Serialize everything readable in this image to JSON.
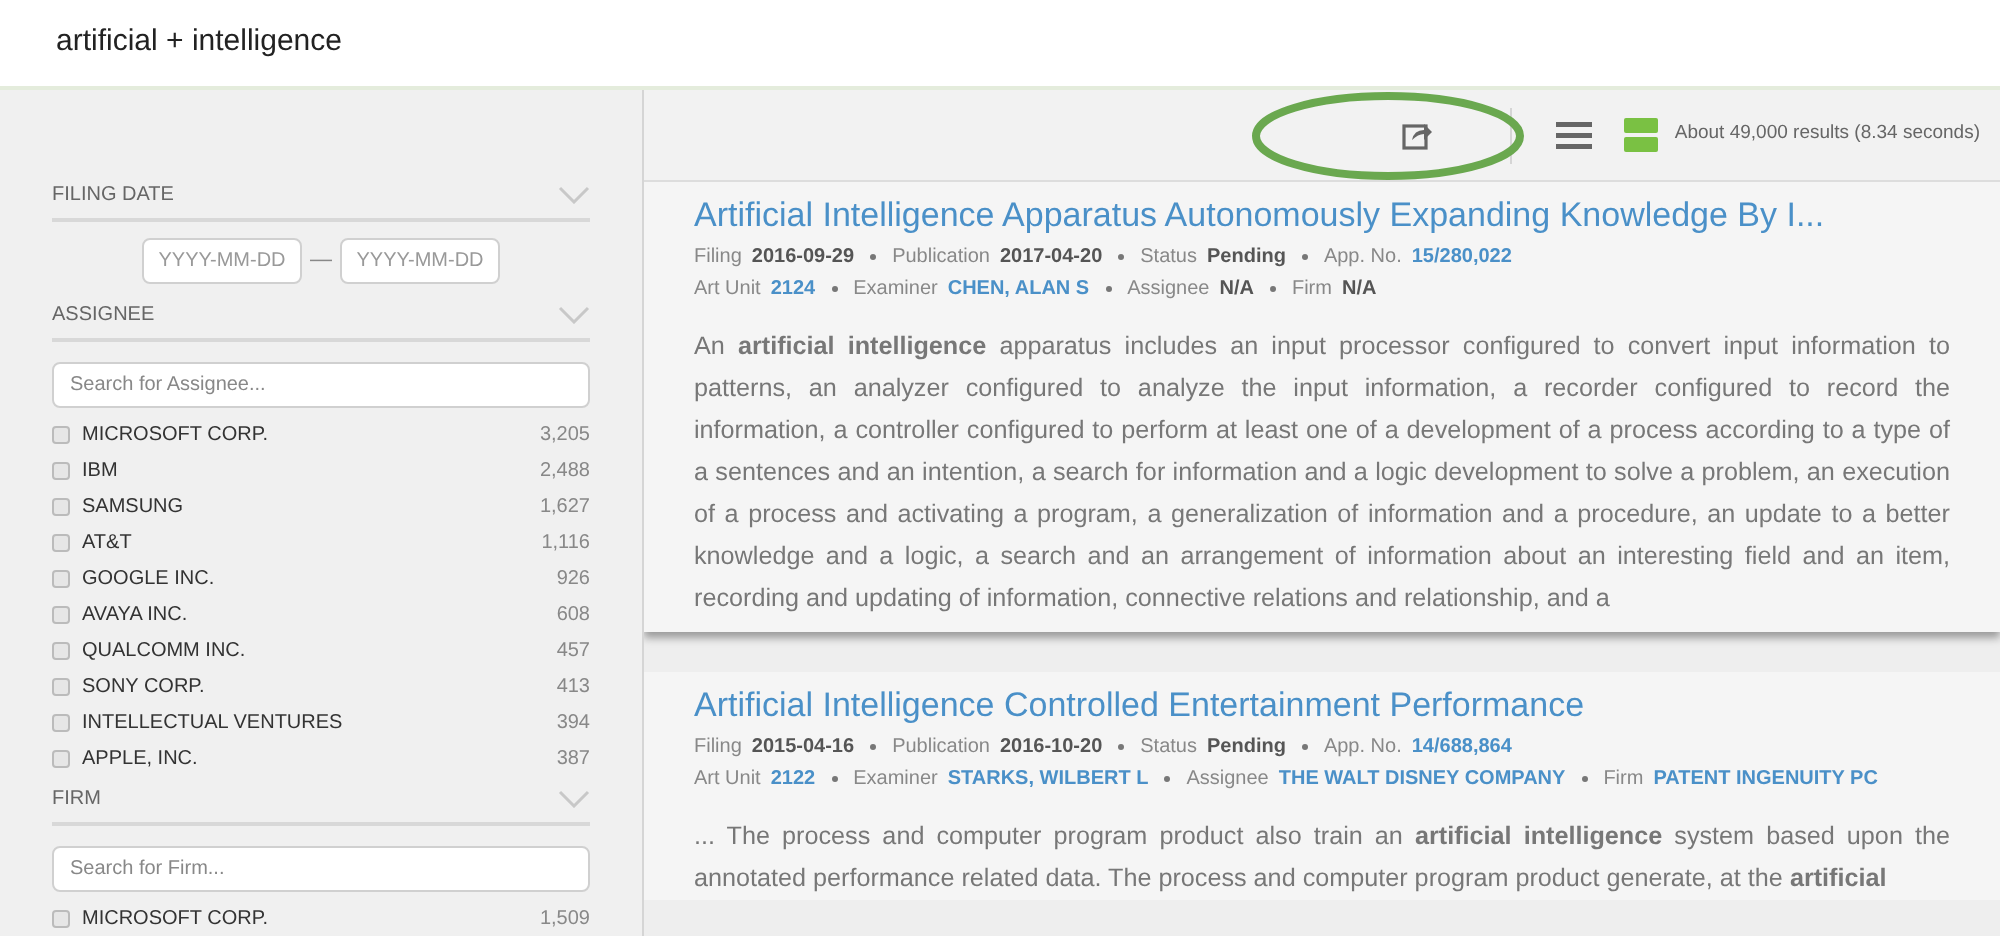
{
  "header": {
    "query": "artificial + intelligence"
  },
  "sidebar": {
    "sections": [
      {
        "title": "FILING DATE",
        "kind": "date",
        "from_placeholder": "YYYY-MM-DD",
        "separator": "—",
        "to_placeholder": "YYYY-MM-DD"
      },
      {
        "title": "ASSIGNEE",
        "kind": "list",
        "placeholder": "Search for Assignee...",
        "items": [
          {
            "name": "MICROSOFT CORP.",
            "count": "3,205",
            "checked": false
          },
          {
            "name": "IBM",
            "count": "2,488",
            "checked": false
          },
          {
            "name": "SAMSUNG",
            "count": "1,627",
            "checked": false
          },
          {
            "name": "AT&T",
            "count": "1,116",
            "checked": false
          },
          {
            "name": "GOOGLE INC.",
            "count": "926",
            "checked": false
          },
          {
            "name": "AVAYA INC.",
            "count": "608",
            "checked": false
          },
          {
            "name": "QUALCOMM INC.",
            "count": "457",
            "checked": false
          },
          {
            "name": "SONY CORP.",
            "count": "413",
            "checked": false
          },
          {
            "name": "INTELLECTUAL VENTURES",
            "count": "394",
            "checked": false
          },
          {
            "name": "APPLE, INC.",
            "count": "387",
            "checked": false
          }
        ]
      },
      {
        "title": "FIRM",
        "kind": "list",
        "placeholder": "Search for Firm...",
        "items": [
          {
            "name": "MICROSOFT CORP.",
            "count": "1,509",
            "checked": false
          }
        ]
      }
    ]
  },
  "toolbar": {
    "share_highlighted": true,
    "results_summary": "About 49,000 results (8.34 seconds)"
  },
  "results": [
    {
      "title": "Artificial Intelligence Apparatus Autonomously Expanding Knowledge By I...",
      "meta_rows": [
        [
          {
            "label": "Filing",
            "value": "2016-09-29",
            "kind": "plain"
          },
          {
            "label": "Publication",
            "value": "2017-04-20",
            "kind": "plain"
          },
          {
            "label": "Status",
            "value": "Pending",
            "kind": "plain"
          },
          {
            "label": "App. No.",
            "value": "15/280,022",
            "kind": "link"
          }
        ],
        [
          {
            "label": "Art Unit",
            "value": "2124",
            "kind": "link"
          },
          {
            "label": "Examiner",
            "value": "CHEN, ALAN S",
            "kind": "link"
          },
          {
            "label": "Assignee",
            "value": "N/A",
            "kind": "plain"
          },
          {
            "label": "Firm",
            "value": "N/A",
            "kind": "plain"
          }
        ]
      ],
      "abstract": "An **artificial intelligence** apparatus includes an input processor configured to convert input information to patterns, an analyzer configured to analyze the input information, a recorder configured to record the information, a controller configured to perform at least one of a development of a process according to a type of a sentences and an intention, a search for information and a logic development to solve a problem, an execution of a process and activating a program, a generalization of information and a procedure, an update to a better knowledge and a logic, a search and an arrangement of information about an interesting field and an item, recording and updating of information, connective relations and relationship, and a"
    },
    {
      "title": "Artificial Intelligence Controlled Entertainment Performance",
      "meta_rows": [
        [
          {
            "label": "Filing",
            "value": "2015-04-16",
            "kind": "plain"
          },
          {
            "label": "Publication",
            "value": "2016-10-20",
            "kind": "plain"
          },
          {
            "label": "Status",
            "value": "Pending",
            "kind": "plain"
          },
          {
            "label": "App. No.",
            "value": "14/688,864",
            "kind": "link"
          }
        ],
        [
          {
            "label": "Art Unit",
            "value": "2122",
            "kind": "link"
          },
          {
            "label": "Examiner",
            "value": "STARKS, WILBERT L",
            "kind": "link"
          },
          {
            "label": "Assignee",
            "value": "THE WALT DISNEY COMPANY",
            "kind": "link"
          },
          {
            "label": "Firm",
            "value": "PATENT INGENUITY PC",
            "kind": "link"
          }
        ]
      ],
      "abstract": "... The process and computer program product also train an **artificial intelligence** system based upon the annotated performance related data. The process and computer program product generate, at the **artificial**"
    }
  ]
}
